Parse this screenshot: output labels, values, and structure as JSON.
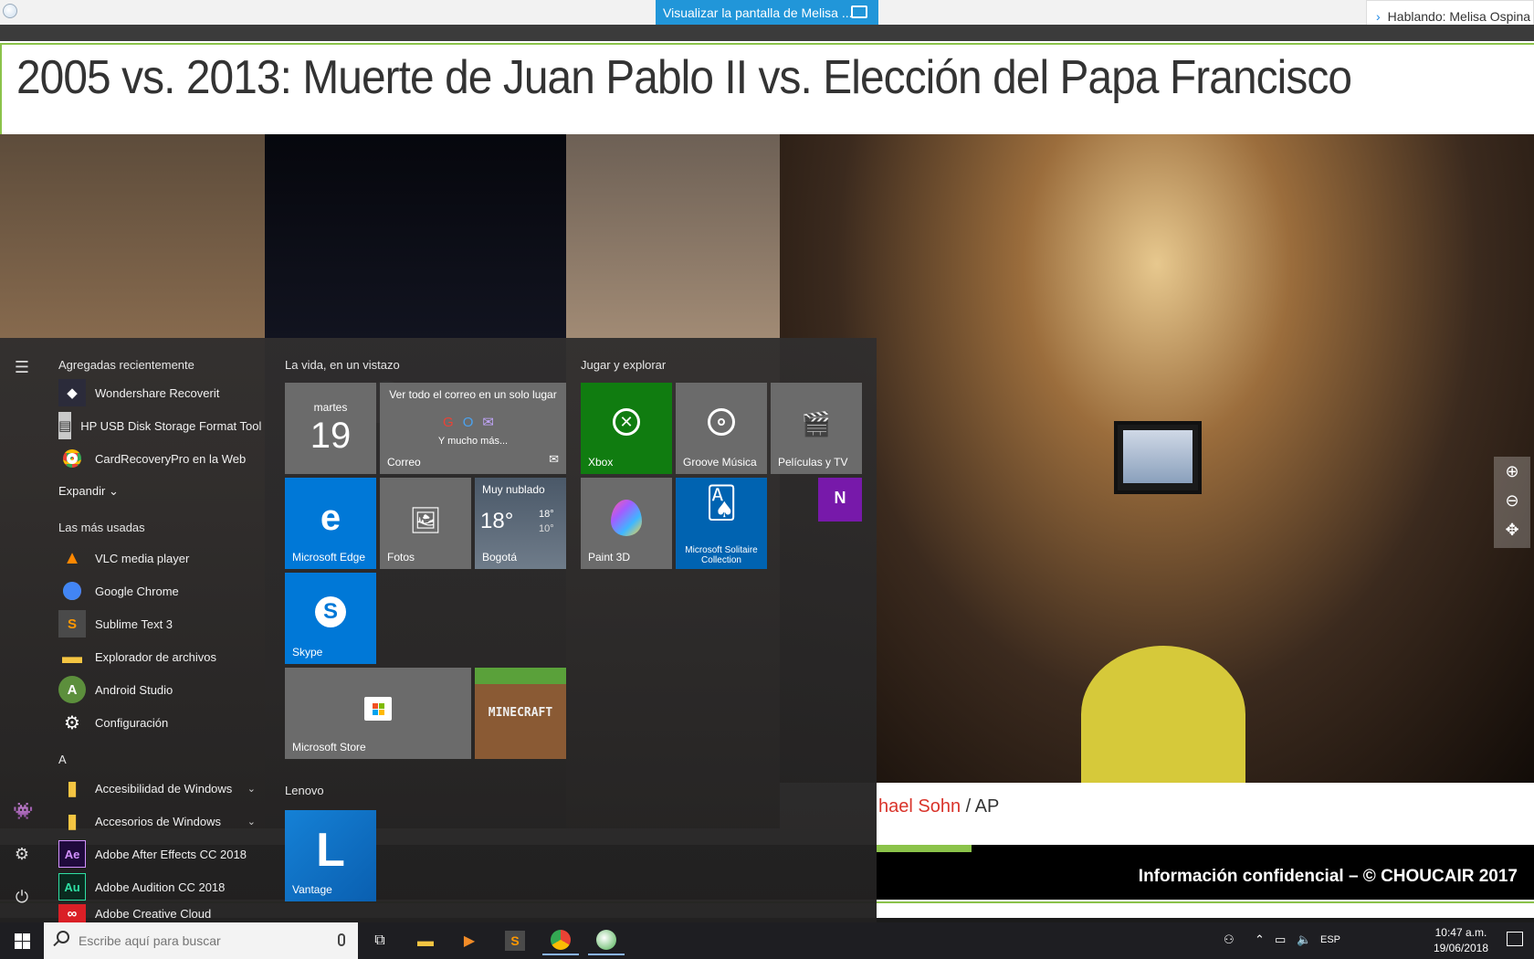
{
  "topbar": {
    "share_label": "Visualizar la pantalla de Melisa ...",
    "talking_label": "Hablando: Melisa Ospina"
  },
  "slide": {
    "title": "2005 vs. 2013: Muerte de Juan Pablo II vs. Elección del Papa Francisco",
    "credit_name": "hael Sohn",
    "credit_sep": " / ",
    "credit_agency": "AP",
    "footer": "Información confidencial – © CHOUCAIR 2017"
  },
  "start_menu": {
    "recent_header": "Agregadas recientemente",
    "recent": [
      "Wondershare Recoverit",
      "HP USB Disk Storage Format Tool",
      "CardRecoveryPro en la Web"
    ],
    "expand_label": "Expandir",
    "most_used_header": "Las más usadas",
    "most_used": [
      "VLC media player",
      "Google Chrome",
      "Sublime Text 3",
      "Explorador de archivos",
      "Android Studio",
      "Configuración"
    ],
    "letter_a": "A",
    "a_items": [
      "Accesibilidad de Windows",
      "Accesorios de Windows",
      "Adobe After Effects CC 2018",
      "Adobe Audition CC 2018",
      "Adobe Creative Cloud"
    ],
    "group_life": "La vida, en un vistazo",
    "group_play": "Jugar y explorar",
    "group_lenovo": "Lenovo",
    "tiles": {
      "calendar_day": "martes",
      "calendar_date": "19",
      "mail_top": "Ver todo el correo en un solo lugar",
      "mail_more": "Y mucho más...",
      "mail_name": "Correo",
      "edge": "Microsoft Edge",
      "photos": "Fotos",
      "weather_cond": "Muy nublado",
      "weather_temp": "18°",
      "weather_hi": "18°",
      "weather_lo": "10°",
      "weather_city": "Bogotá",
      "skype": "Skype",
      "store": "Microsoft Store",
      "minecraft": "MINECRAFT",
      "xbox": "Xbox",
      "groove": "Groove Música",
      "movies": "Películas y TV",
      "paint3d": "Paint 3D",
      "solitaire": "Microsoft Solitaire Collection",
      "vantage": "Vantage"
    }
  },
  "taskbar": {
    "search_placeholder": "Escribe aquí para buscar",
    "lang": "ESP",
    "time": "10:47 a.m.",
    "date": "19/06/2018"
  },
  "colors": {
    "accent_green": "#8bc34a",
    "share_blue": "#2196d9",
    "tile_blue": "#0078d7",
    "xbox_green": "#107c10"
  }
}
